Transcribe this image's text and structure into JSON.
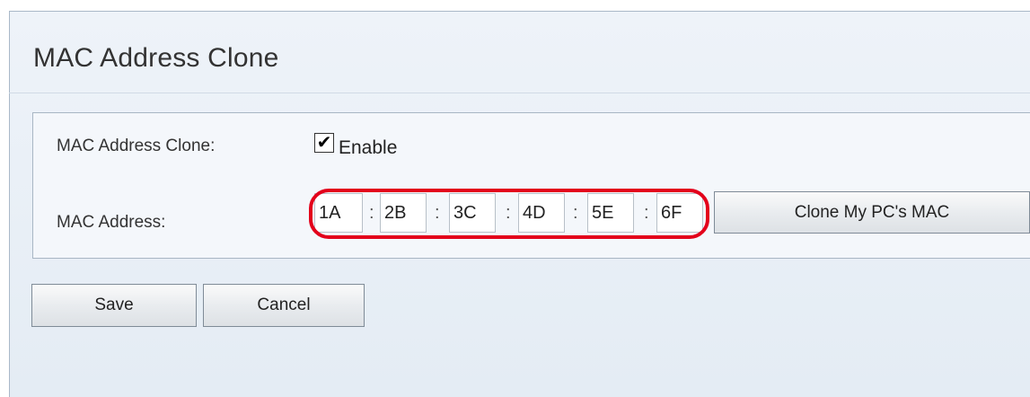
{
  "page": {
    "title": "MAC Address Clone"
  },
  "form": {
    "clone_label": "MAC Address Clone:",
    "enable_checked": true,
    "enable_label": "Enable",
    "mac_label": "MAC Address:",
    "mac_octets": [
      "1A",
      "2B",
      "3C",
      "4D",
      "5E",
      "6F"
    ],
    "separator": ":",
    "clone_button": "Clone My PC's MAC"
  },
  "actions": {
    "save": "Save",
    "cancel": "Cancel"
  },
  "colors": {
    "highlight": "#e3001b",
    "panel_bg": "#e8eef5"
  }
}
